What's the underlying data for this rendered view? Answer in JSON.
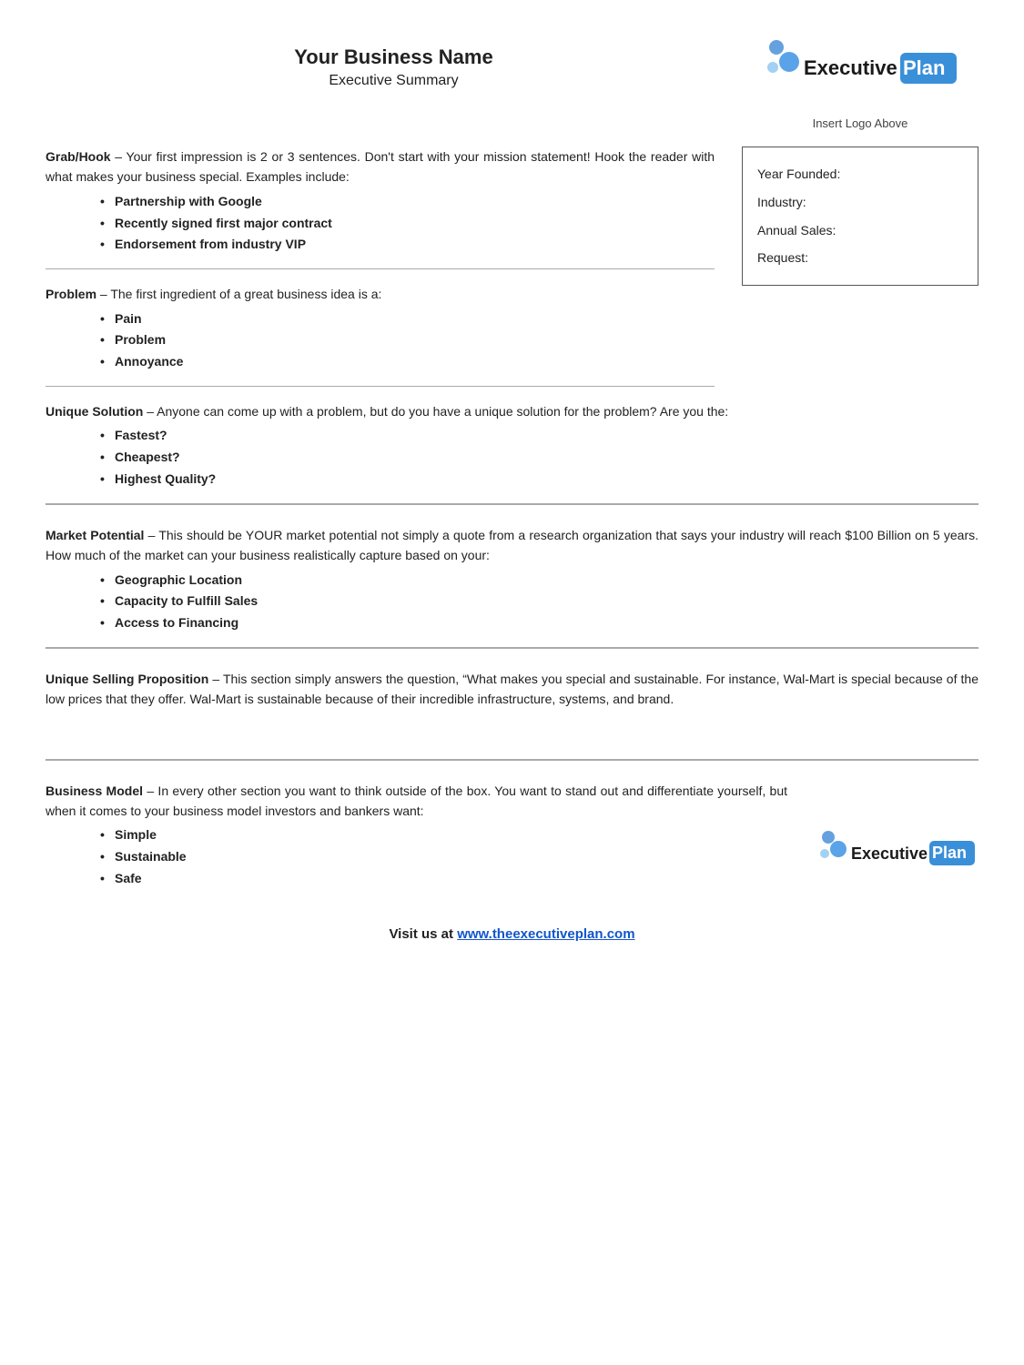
{
  "header": {
    "business_name": "Your Business Name",
    "subtitle": "Executive Summary",
    "insert_logo": "Insert Logo Above"
  },
  "grab_hook": {
    "label": "Grab/Hook",
    "text": " – Your first impression is 2 or 3 sentences. Don't start with your mission statement!  Hook the reader with what makes your business special.  Examples include:",
    "bullets": [
      "Partnership with Google",
      "Recently signed first major contract",
      "Endorsement from industry VIP"
    ]
  },
  "info_box": {
    "year_founded_label": "Year Founded:",
    "industry_label": "Industry:",
    "annual_sales_label": "Annual Sales:",
    "request_label": "Request:"
  },
  "problem": {
    "label": "Problem",
    "text": " – The first ingredient of a great business idea is a:",
    "bullets": [
      "Pain",
      "Problem",
      "Annoyance"
    ]
  },
  "unique_solution": {
    "label": "Unique Solution",
    "text": " – Anyone can come up with a problem, but do you have a unique solution for the problem?  Are you the:",
    "bullets": [
      "Fastest?",
      "Cheapest?",
      "Highest Quality?"
    ]
  },
  "market_potential": {
    "label": "Market Potential",
    "text": "  – This should be YOUR market potential not simply a quote from a research organization that says your industry will reach $100 Billion on 5 years.  How much of the market can your business realistically capture based on your:",
    "bullets": [
      "Geographic Location",
      "Capacity to Fulfill Sales",
      "Access to Financing"
    ]
  },
  "usp": {
    "label": "Unique Selling Proposition",
    "text": " – This section simply answers the question, “What makes you special and sustainable.  For instance, Wal-Mart is special because of the low prices that they offer.  Wal-Mart is sustainable because of their incredible infrastructure, systems, and brand."
  },
  "business_model": {
    "label": "Business Model",
    "text": " – In every other section you want to think outside of the box.  You want to stand out and differentiate yourself, but when it comes to your business model investors and bankers want:",
    "bullets": [
      "Simple",
      "Sustainable",
      "Safe"
    ]
  },
  "footer": {
    "text": "Visit us at ",
    "link_text": "www.theexecutiveplan.com",
    "link_href": "http://www.theexecutiveplan.com"
  }
}
